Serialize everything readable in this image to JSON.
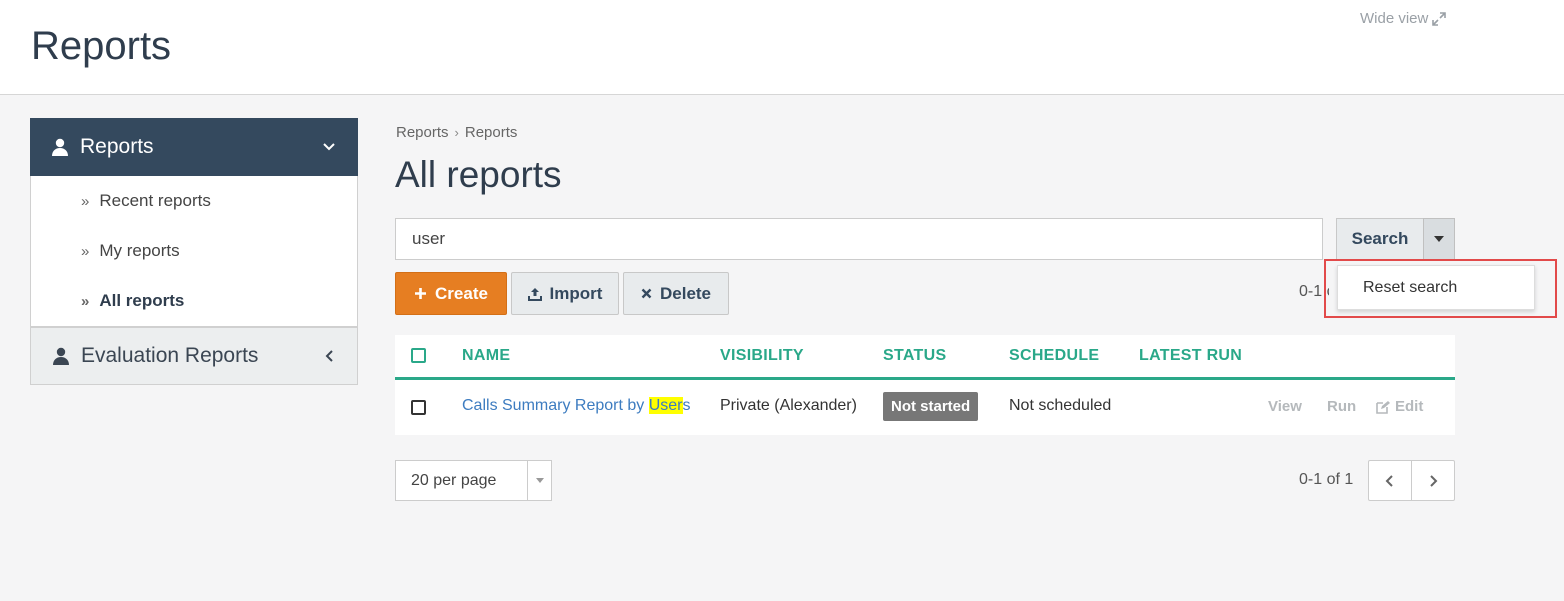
{
  "header": {
    "title": "Reports",
    "wide_view": "Wide view"
  },
  "sidebar": {
    "section": "Reports",
    "items": [
      {
        "label": "Recent reports",
        "active": false
      },
      {
        "label": "My reports",
        "active": false
      },
      {
        "label": "All reports",
        "active": true
      }
    ],
    "eval_section": "Evaluation Reports"
  },
  "breadcrumb": [
    "Reports",
    "Reports"
  ],
  "main": {
    "title": "All reports"
  },
  "search": {
    "value": "user",
    "button": "Search",
    "dropdown_item": "Reset search"
  },
  "toolbar": {
    "create": "Create",
    "import": "Import",
    "delete": "Delete",
    "range_partial": "0-1 o"
  },
  "table": {
    "headers": [
      "NAME",
      "VISIBILITY",
      "STATUS",
      "SCHEDULE",
      "LATEST RUN"
    ],
    "rows": [
      {
        "name_pre": "Calls Summary Report by ",
        "name_hl": "User",
        "name_post": "s",
        "visibility": "Private (Alexander)",
        "status": "Not started",
        "schedule": "Not scheduled",
        "latest_run": "",
        "actions": {
          "view": "View",
          "run": "Run",
          "edit": "Edit"
        }
      }
    ]
  },
  "pagination": {
    "per_page": "20 per page",
    "range": "0-1 of 1"
  },
  "colors": {
    "accent": "#2aa889",
    "create": "#e67e22",
    "nav": "#34495e",
    "highlight_box": "#e24a4a"
  }
}
